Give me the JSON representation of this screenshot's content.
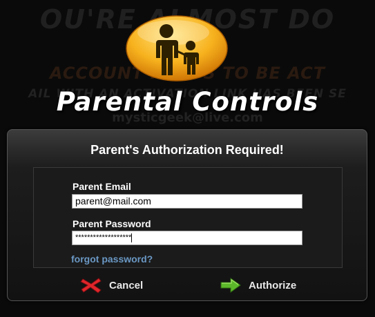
{
  "background": {
    "line1": "OU'RE ALMOST DO",
    "line2": "ACCOUNT NEEDS TO BE ACT",
    "line3": "AIL WITH AN ACTIVATION LINK HAS BEEN SE",
    "line4": "mysticgeek@live.com"
  },
  "logo": {
    "icon": "parent-child-icon",
    "color": "#f5a31a"
  },
  "app_title": "Parental Controls",
  "dialog": {
    "title": "Parent's Authorization Required!",
    "email_label": "Parent Email",
    "email_value": "parent@mail.com",
    "password_label": "Parent Password",
    "password_value": "*******************",
    "forgot_link": "forgot password?",
    "cancel_label": "Cancel",
    "authorize_label": "Authorize"
  },
  "colors": {
    "cancel_icon": "#e0262b",
    "authorize_icon": "#5cb82a",
    "link": "#6a98c4"
  }
}
